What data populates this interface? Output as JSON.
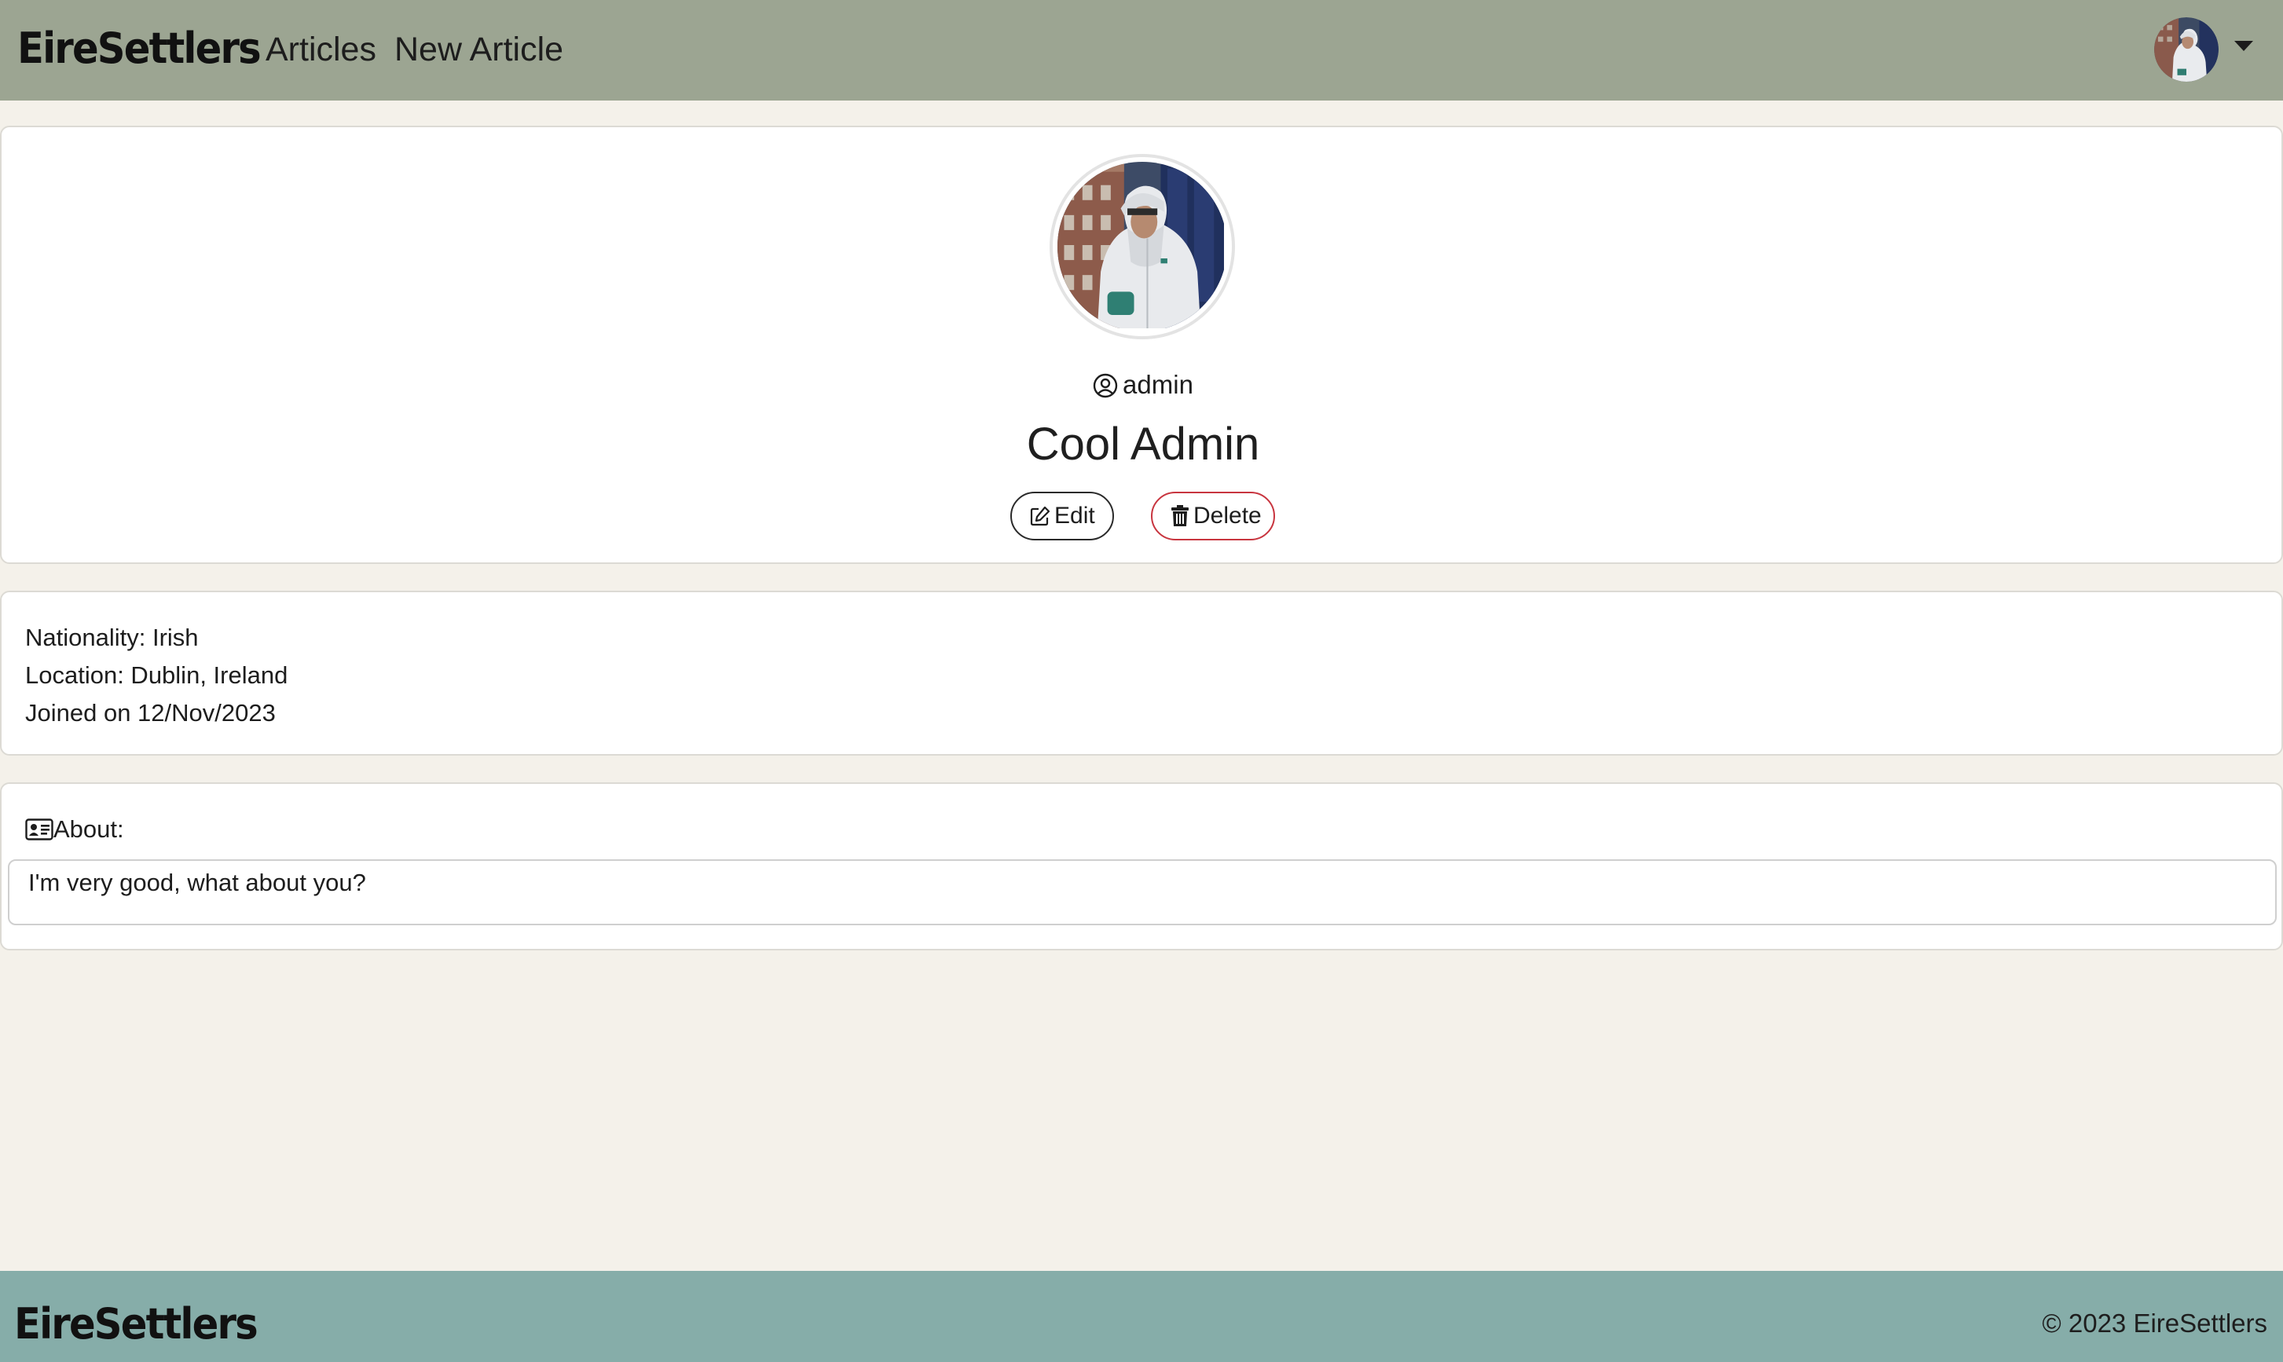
{
  "nav": {
    "brand": "EireSettlers",
    "links": [
      "Articles",
      "New Article"
    ]
  },
  "profile": {
    "username": "admin",
    "display_name": "Cool Admin",
    "edit_label": "Edit",
    "delete_label": "Delete"
  },
  "details": {
    "nationality": "Nationality: Irish",
    "location": "Location: Dublin, Ireland",
    "joined": "Joined on 12/Nov/2023"
  },
  "about": {
    "label": "About:",
    "text": "I'm very good, what about you?"
  },
  "footer": {
    "brand": "EireSettlers",
    "copyright": "© 2023 EireSettlers"
  },
  "icons": {
    "user": "user-circle-icon",
    "edit": "pencil-square-icon",
    "delete": "trash-icon",
    "about": "id-card-icon",
    "menu": "caret-down-icon"
  },
  "colors": {
    "navbar": "#9ca592",
    "footer": "#86ada9",
    "background": "#f4f1ea",
    "delete_border": "#c8353f"
  }
}
